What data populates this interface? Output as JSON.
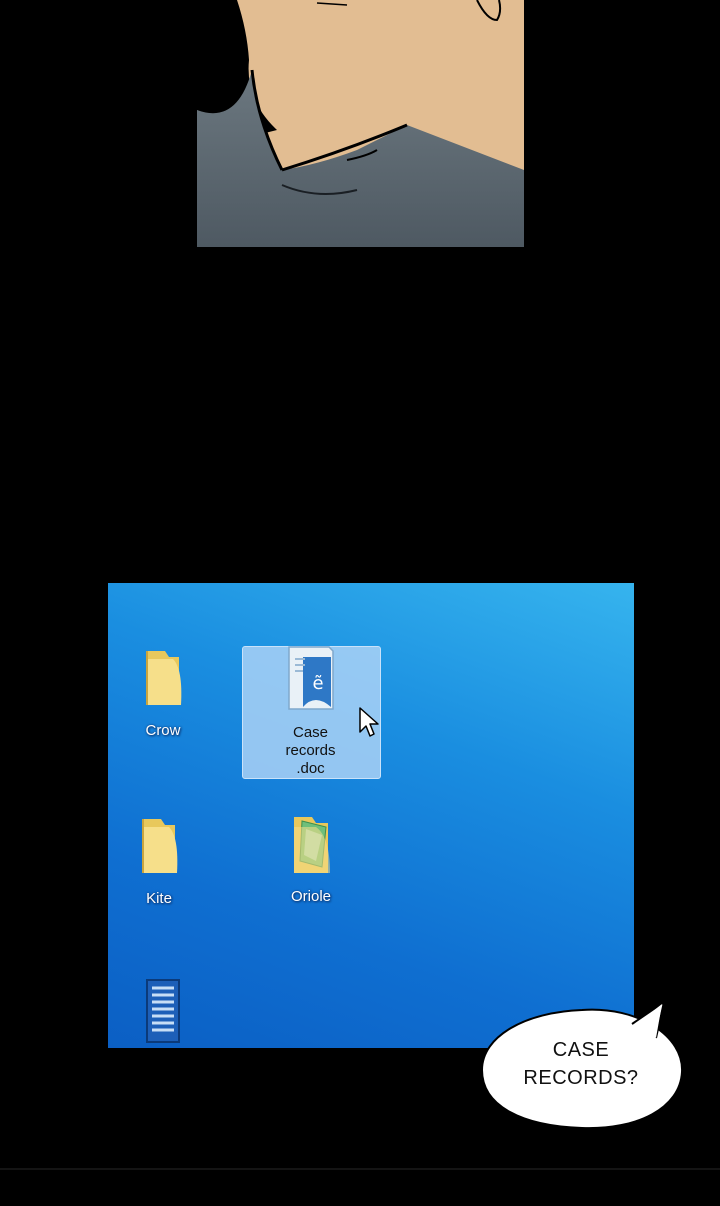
{
  "desktop": {
    "icons": [
      {
        "label": "Crow",
        "icon": "folder-icon"
      },
      {
        "label": "Case records .doc",
        "label_lines": [
          "Case",
          "records",
          ".doc"
        ],
        "icon": "document-icon",
        "selected": true
      },
      {
        "label": "Kite",
        "icon": "folder-icon"
      },
      {
        "label": "Oriole",
        "icon": "folder-with-files-icon"
      },
      {
        "label": "",
        "icon": "archive-icon"
      }
    ],
    "cursor": "mouse-pointer-icon"
  },
  "bubble": {
    "lines": [
      "CASE",
      "RECORDS?"
    ]
  },
  "colors": {
    "background": "#000000",
    "desktop_blue": "#1a8ee0",
    "skin": "#e2bd92",
    "coat": "#5f6a73",
    "selection": "#b0d4f6"
  }
}
